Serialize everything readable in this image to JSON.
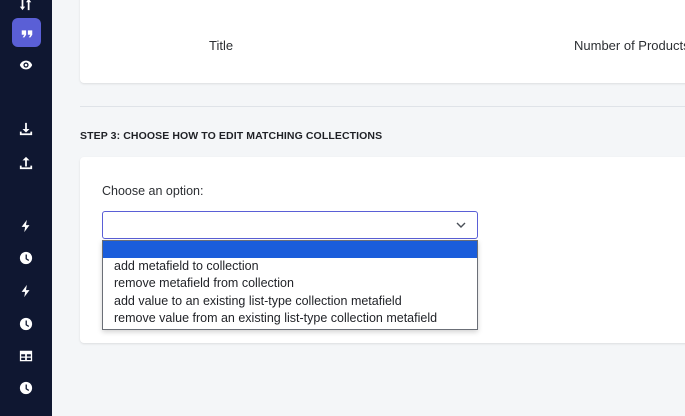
{
  "sidebar": {
    "icons": [
      "sort-icon",
      "quote-icon",
      "eye-icon",
      "download-icon",
      "upload-icon",
      "bolt-icon",
      "clock-icon",
      "bolt-icon",
      "clock-icon",
      "table-icon",
      "clock-icon"
    ],
    "active_icon": "quote-icon",
    "colors": {
      "background": "#0f1731",
      "active": "#5a5fd6"
    }
  },
  "table": {
    "columns": [
      "Title",
      "Number of Products"
    ]
  },
  "step": {
    "title": "STEP 3: CHOOSE HOW TO EDIT MATCHING COLLECTIONS"
  },
  "form": {
    "label": "Choose an option:",
    "selected_value": "",
    "options": [
      "",
      "add metafield to collection",
      "remove metafield from collection",
      "add value to an existing list-type collection metafield",
      "remove value from an existing list-type collection metafield"
    ],
    "highlighted_option": 0
  },
  "colors": {
    "accent": "#5a5fd6",
    "option_highlight": "#1a5ddb"
  }
}
